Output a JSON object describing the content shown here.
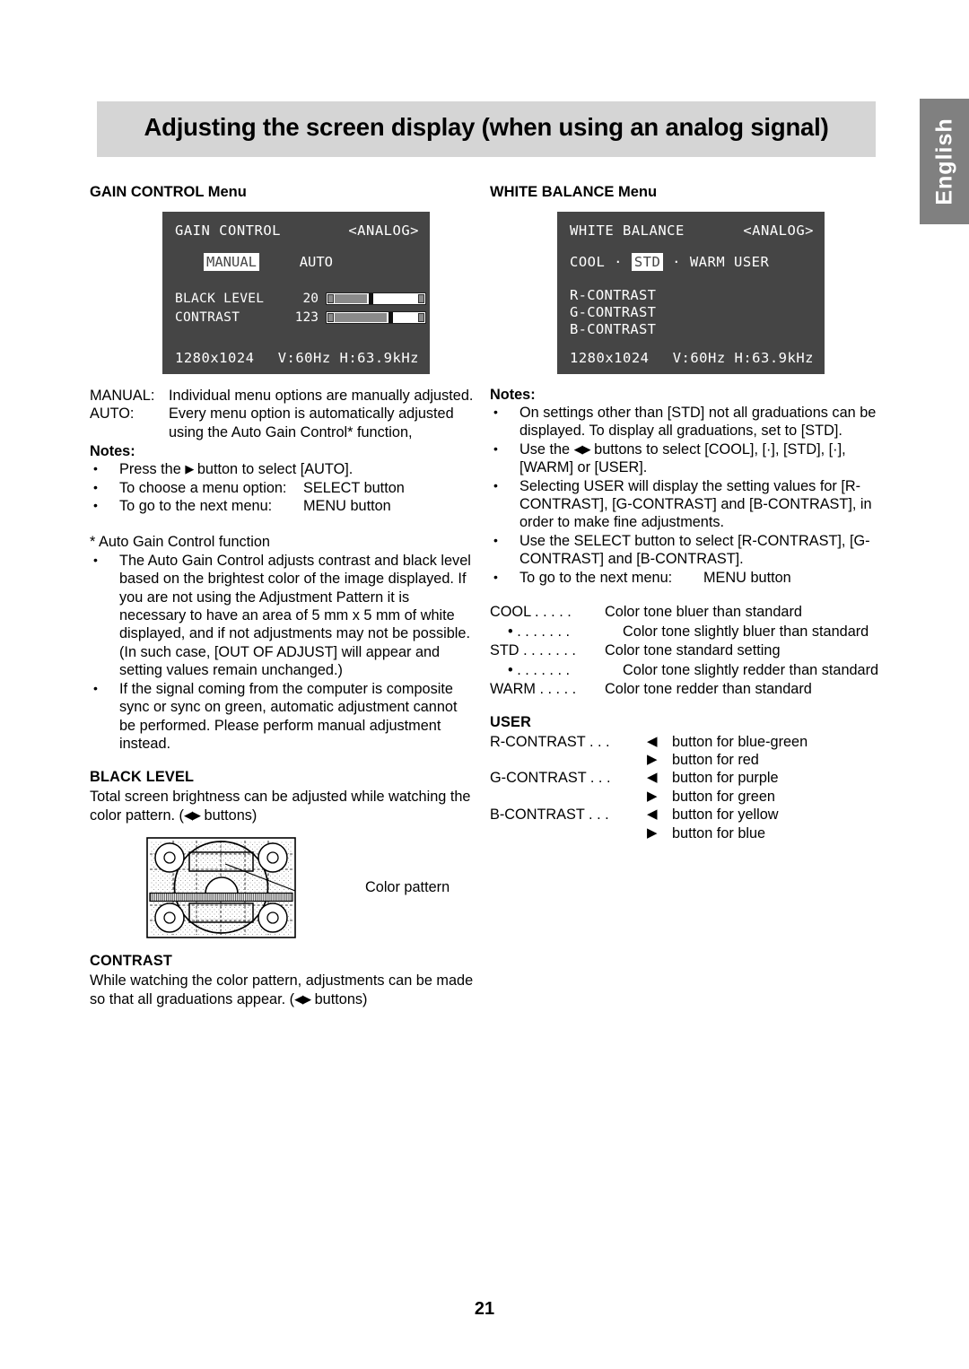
{
  "header": {
    "title": "Adjusting the screen display (when using an analog signal)",
    "language_tab": "English",
    "banner_color": "#d5d5d5",
    "tab_color": "#808080"
  },
  "page_number": "21",
  "left_column": {
    "section_title": "GAIN CONTROL Menu",
    "osd": {
      "title": "GAIN CONTROL",
      "signal": "<ANALOG>",
      "mode_selected": "MANUAL",
      "mode_other": "AUTO",
      "rows": [
        {
          "label": "BLACK LEVEL",
          "value": "20",
          "fill_percent": 38,
          "thumb_percent": 40
        },
        {
          "label": "CONTRAST",
          "value": "123",
          "fill_percent": 62,
          "thumb_percent": 64
        }
      ],
      "resolution": "1280x1024",
      "frequency": "V:60Hz H:63.9kHz",
      "background_color": "#454545"
    },
    "definitions": [
      {
        "term": "MANUAL:",
        "desc": "Individual menu options are manually adjusted."
      },
      {
        "term": "AUTO:",
        "desc": "Every menu option is automatically adjusted using the Auto Gain Control* function,"
      }
    ],
    "notes_label": "Notes:",
    "notes": [
      {
        "type": "text",
        "before": "Press the ",
        "arrow": "▶",
        "after": " button to select [AUTO]."
      },
      {
        "type": "tabbed",
        "left": "To choose a menu option:",
        "right": "SELECT button"
      },
      {
        "type": "tabbed",
        "left": "To go to the next menu:",
        "right": "MENU button"
      }
    ],
    "star_note_title": "* Auto Gain Control function",
    "star_notes": [
      "The Auto Gain Control adjusts contrast and black level based on the brightest color of the image displayed. If you are not using the Adjustment Pattern it is necessary to have an area of 5 mm x 5 mm of white displayed, and if not adjustments may not be possible. (In such case, [OUT OF ADJUST] will appear and setting values remain unchanged.)",
      "If the signal coming from the computer is composite sync or sync on green, automatic adjustment cannot be performed. Please perform manual adjustment instead."
    ],
    "black_level": {
      "heading": "BLACK LEVEL",
      "text_before": "Total screen brightness can be adjusted while watching the color pattern. (",
      "arrows": "◀▶",
      "text_after": " buttons)"
    },
    "figure_caption": "Color pattern",
    "contrast": {
      "heading": "CONTRAST",
      "text_before": "While watching the color pattern, adjustments can be made so that all graduations appear. (",
      "arrows": "◀▶",
      "text_after": " buttons)"
    }
  },
  "right_column": {
    "section_title": "WHITE BALANCE Menu",
    "osd": {
      "title": "WHITE BALANCE",
      "signal": "<ANALOG>",
      "modes_before": "COOL · ",
      "mode_selected": "STD",
      "modes_after": " · WARM  USER",
      "list": [
        "R-CONTRAST",
        "G-CONTRAST",
        "B-CONTRAST"
      ],
      "resolution": "1280x1024",
      "frequency": "V:60Hz H:63.9kHz",
      "background_color": "#454545"
    },
    "notes_label": "Notes:",
    "notes": [
      {
        "type": "plain",
        "text": "On settings other than [STD] not all graduations can be displayed. To display all graduations, set to [STD]."
      },
      {
        "type": "arrows",
        "before": "Use the ",
        "arrows": "◀▶",
        "after": " buttons to select [COOL], [·], [STD], [·], [WARM] or [USER]."
      },
      {
        "type": "plain",
        "text": "Selecting USER will display the setting values for [R-CONTRAST], [G-CONTRAST] and [B-CONTRAST], in order to make fine adjustments."
      },
      {
        "type": "plain",
        "text": "Use the SELECT button to select [R-CONTRAST], [G-CONTRAST] and [B-CONTRAST]."
      },
      {
        "type": "tabbed",
        "left": "To go to the next menu:",
        "right": "MENU button"
      }
    ],
    "tone_rows": [
      {
        "key": "COOL . . . . .",
        "desc": "Color tone bluer than standard",
        "indent": false
      },
      {
        "key": "•   . . . . . . .",
        "desc": "Color tone slightly bluer than standard",
        "indent": true
      },
      {
        "key": "STD . . . . . . .",
        "desc": "Color tone standard setting",
        "indent": false
      },
      {
        "key": "•   . . . . . . .",
        "desc": "Color tone slightly redder than standard",
        "indent": true
      },
      {
        "key": "WARM . . . . .",
        "desc": "Color tone redder than standard",
        "indent": false
      }
    ],
    "user_heading": "USER",
    "user_rows": [
      {
        "key": "R-CONTRAST  . . .",
        "arrow": "◀",
        "desc": "button for blue-green"
      },
      {
        "key": "",
        "arrow": "▶",
        "desc": "button for red"
      },
      {
        "key": "G-CONTRAST  . . .",
        "arrow": "◀",
        "desc": "button for purple"
      },
      {
        "key": "",
        "arrow": "▶",
        "desc": "button for green"
      },
      {
        "key": "B-CONTRAST  . . .",
        "arrow": "◀",
        "desc": "button for yellow"
      },
      {
        "key": "",
        "arrow": "▶",
        "desc": "button for blue"
      }
    ]
  }
}
